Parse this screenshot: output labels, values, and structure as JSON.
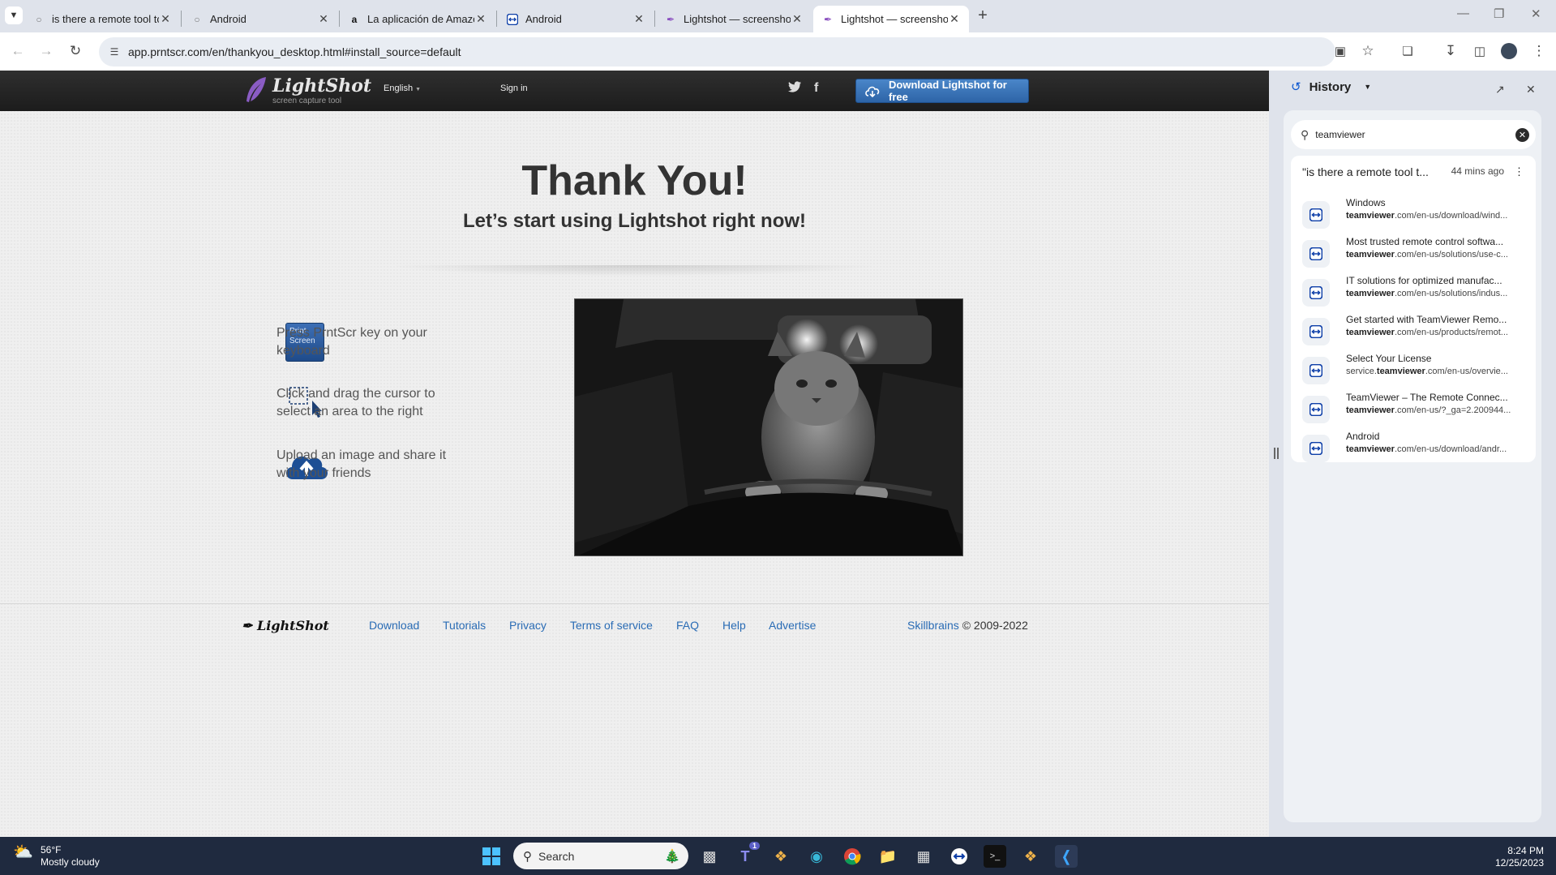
{
  "browser": {
    "tabs": [
      {
        "title": "is there a remote tool to remot",
        "icon": "google-icon",
        "active": false
      },
      {
        "title": "Android",
        "icon": "globe-icon",
        "active": false
      },
      {
        "title": "La aplicación de Amazon",
        "icon": "amazon-icon",
        "active": false
      },
      {
        "title": "Android",
        "icon": "teamviewer-icon",
        "active": false
      },
      {
        "title": "Lightshot — screenshot tool fo",
        "icon": "lightshot-icon",
        "active": false
      },
      {
        "title": "Lightshot — screenshot tool fo",
        "icon": "lightshot-icon",
        "active": true
      }
    ],
    "url": "app.prntscr.com/en/thankyou_desktop.html#install_source=default"
  },
  "site": {
    "logo_name": "LightShot",
    "logo_tagline": "screen capture tool",
    "language": "English",
    "sign_in": "Sign in",
    "download_button": "Download Lightshot for free",
    "heading": "Thank You!",
    "subheading": "Let’s start using Lightshot right now!",
    "key_label_1": "Print",
    "key_label_2": "Screen",
    "steps": [
      {
        "text": "Press PrntScr key on your keyboard"
      },
      {
        "text": "Click and drag the cursor to select an area to the right"
      },
      {
        "text": "Upload an image and share it with your friends"
      }
    ],
    "footer": {
      "logo": "LightShot",
      "links": [
        "Download",
        "Tutorials",
        "Privacy",
        "Terms of service",
        "FAQ",
        "Help",
        "Advertise"
      ],
      "company": "Skillbrains",
      "copyright": "© 2009-2022"
    }
  },
  "history": {
    "title": "History",
    "search_value": "teamviewer",
    "group_title": "\"is there a remote tool t...",
    "group_time": "44 mins ago",
    "items": [
      {
        "title": "Windows",
        "domain": "teamviewer",
        "url_prefix": "",
        "url_suffix": ".com/en-us/download/wind..."
      },
      {
        "title": "Most trusted remote control softwa...",
        "domain": "teamviewer",
        "url_prefix": "",
        "url_suffix": ".com/en-us/solutions/use-c..."
      },
      {
        "title": "IT solutions for optimized manufac...",
        "domain": "teamviewer",
        "url_prefix": "",
        "url_suffix": ".com/en-us/solutions/indus..."
      },
      {
        "title": "Get started with TeamViewer Remo...",
        "domain": "teamviewer",
        "url_prefix": "",
        "url_suffix": ".com/en-us/products/remot..."
      },
      {
        "title": "Select Your License",
        "domain": "teamviewer",
        "url_prefix": "service.",
        "url_suffix": ".com/en-us/overvie..."
      },
      {
        "title": "TeamViewer – The Remote Connec...",
        "domain": "teamviewer",
        "url_prefix": "",
        "url_suffix": ".com/en-us/?_ga=2.200944..."
      },
      {
        "title": "Android",
        "domain": "teamviewer",
        "url_prefix": "",
        "url_suffix": ".com/en-us/download/andr..."
      }
    ]
  },
  "taskbar": {
    "weather_temp": "56°F",
    "weather_desc": "Mostly cloudy",
    "search_label": "Search",
    "time": "8:24 PM",
    "date": "12/25/2023",
    "teams_badge": "1"
  },
  "colors": {
    "link": "#2a6cb5",
    "download_button": "#3a75bb",
    "header": "#222222",
    "taskbar": "#1f2a3f"
  }
}
